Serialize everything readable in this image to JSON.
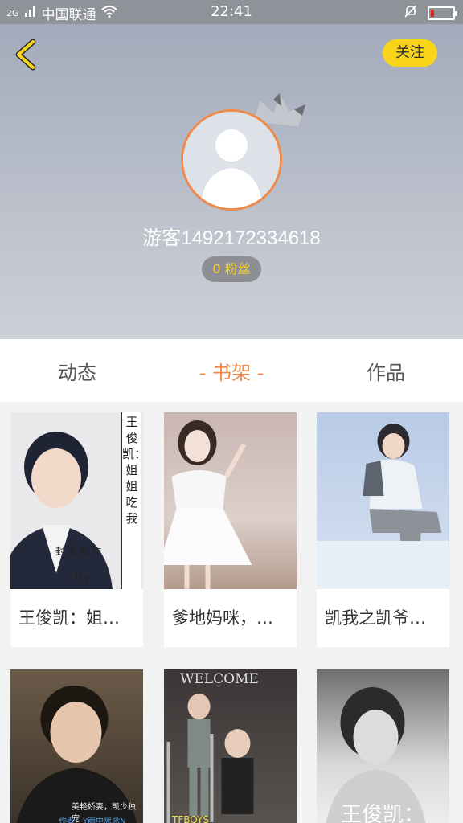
{
  "status_bar": {
    "signal": "2G",
    "carrier": "中国联通",
    "time": "22:41",
    "battery_level": 0.15
  },
  "profile": {
    "follow_label": "关注",
    "username": "游客1492172334618",
    "fans_label": "0 粉丝"
  },
  "tabs": [
    {
      "label": "动态"
    },
    {
      "label": "- 书架 -"
    },
    {
      "label": "作品"
    }
  ],
  "books": [
    {
      "title": "王俊凯：姐…",
      "cover_text": "王俊凯：姐姐吃我",
      "cover_caption": "封面制作",
      "cover_sub": "by"
    },
    {
      "title": "爹地妈咪，…"
    },
    {
      "title": "凯我之凯爷…"
    },
    {
      "title": "",
      "cover_caption": "美艳娇妻，凯少独宠",
      "cover_sub": "作者：Y雨中思念N"
    },
    {
      "title": "",
      "cover_caption": "WELCOME",
      "cover_sub": "TFBOYS"
    },
    {
      "title": "",
      "cover_caption": "王俊凯："
    }
  ],
  "colors": {
    "accent": "#f08a4b",
    "follow": "#f8d51a"
  }
}
